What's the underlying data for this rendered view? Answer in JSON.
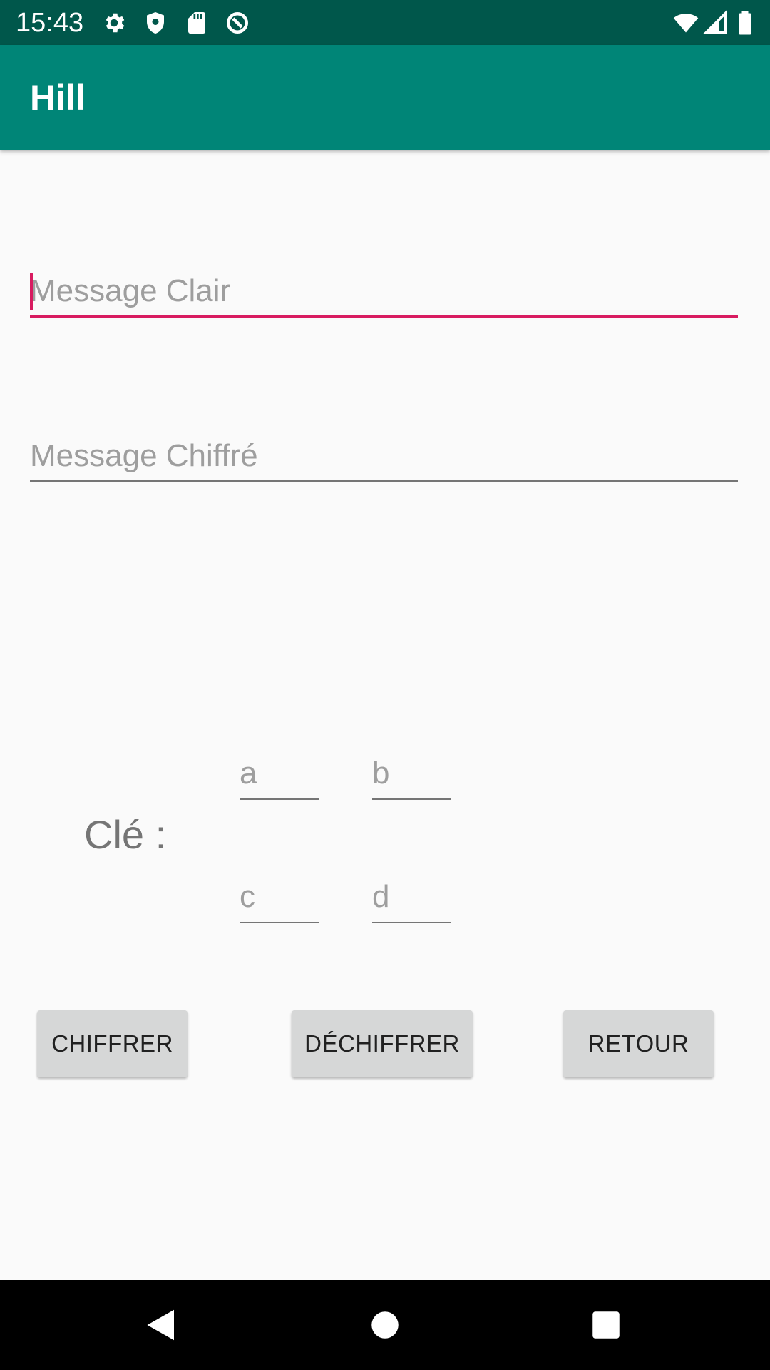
{
  "status_bar": {
    "time": "15:43",
    "icons": [
      "gear-icon",
      "shield-icon",
      "sd-card-icon",
      "data-saver-icon",
      "wifi-icon",
      "signal-icon",
      "battery-icon"
    ]
  },
  "app_bar": {
    "title": "Hill"
  },
  "form": {
    "plain_message": {
      "value": "",
      "placeholder": "Message Clair"
    },
    "cipher_message": {
      "value": "",
      "placeholder": "Message Chiffré"
    },
    "key": {
      "label": "Clé :",
      "a": {
        "value": "",
        "placeholder": "a"
      },
      "b": {
        "value": "",
        "placeholder": "b"
      },
      "c": {
        "value": "",
        "placeholder": "c"
      },
      "d": {
        "value": "",
        "placeholder": "d"
      }
    }
  },
  "buttons": {
    "encrypt": "CHIFFRER",
    "decrypt": "DÉCHIFFRER",
    "back": "RETOUR"
  },
  "colors": {
    "status_bar": "#00574b",
    "app_bar": "#008577",
    "accent": "#d81b60",
    "background": "#fafafa",
    "button": "#d6d7d7"
  },
  "nav_bar": {
    "icons": [
      "back-icon",
      "home-icon",
      "recents-icon"
    ]
  }
}
